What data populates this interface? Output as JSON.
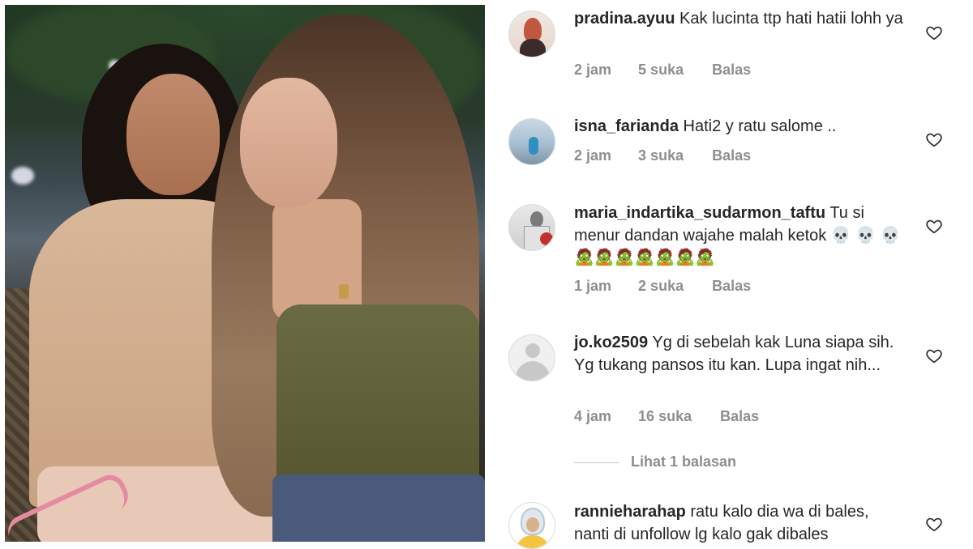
{
  "comments": [
    {
      "username": "pradina.ayuu",
      "text": "Kak lucinta ttp hati hatii lohh ya",
      "time": "2 jam",
      "likes": "5 suka",
      "reply": "Balas"
    },
    {
      "username": "isna_farianda",
      "text": "Hati2 y ratu salome ..",
      "time": "2 jam",
      "likes": "3 suka",
      "reply": "Balas"
    },
    {
      "username": "maria_indartika_sudarmon_taftu",
      "text": "Tu  si menur dandan wajahe malah ketok 💀 💀 💀 🧟🧟🧟🧟🧟🧟🧟",
      "time": "1 jam",
      "likes": "2 suka",
      "reply": "Balas"
    },
    {
      "username": "jo.ko2509",
      "text": "Yg di sebelah kak Luna siapa sih. Yg tukang pansos itu kan. Lupa ingat nih...",
      "time": "4 jam",
      "likes": "16 suka",
      "reply": "Balas"
    },
    {
      "username": "rannieharahap",
      "text": "ratu kalo dia wa di bales, nanti di unfollow lg kalo gak dibales"
    }
  ],
  "view_replies": "Lihat 1 balasan",
  "icons": {
    "like": "heart-outline-icon",
    "avatar_placeholder": "user-placeholder-icon"
  },
  "colors": {
    "text": "#262626",
    "meta": "#8e8e8e"
  }
}
